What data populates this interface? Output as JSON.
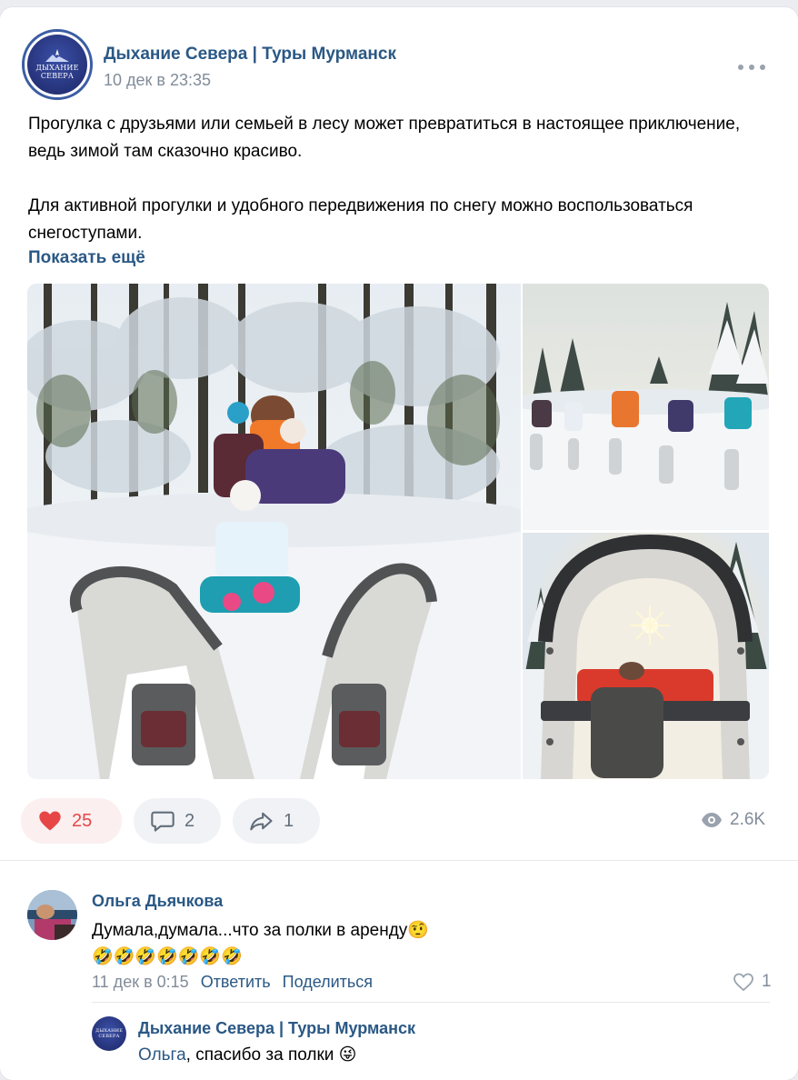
{
  "post": {
    "author": "Дыхание Севера | Туры Мурманск",
    "avatar_text_line1": "ДЫХАНИЕ",
    "avatar_text_line2": "СЕВЕРА",
    "date": "10 дек в 23:35",
    "more_icon": "more-horizontal-icon",
    "paragraph1": "Прогулка с друзьями или семьей в лесу может превратиться в настоящее приключение, ведь зимой там сказочно красиво.",
    "paragraph2": "Для активной прогулки и удобного передвижения по снегу можно воспользоваться снегоступами.",
    "show_more": "Показать ещё",
    "photos": [
      "family-snowshoes-photo",
      "group-hiking-photo",
      "snowshoe-sun-photo"
    ]
  },
  "actions": {
    "likes": "25",
    "comments": "2",
    "shares": "1",
    "views": "2.6K",
    "colors": {
      "like": "#e64646",
      "link": "#2a5885",
      "muted": "#818c99"
    }
  },
  "comment": {
    "author": "Ольга Дьячкова",
    "text": "Думала,думала...что за полки в аренду🤨",
    "emojis": "🤣🤣🤣🤣🤣🤣🤣",
    "date": "11 дек в 0:15",
    "reply_label": "Ответить",
    "share_label": "Поделиться",
    "likes": "1"
  },
  "reply": {
    "author": "Дыхание Севера | Туры Мурманск",
    "mention": "Ольга",
    "text": ", спасибо за полки 😜"
  }
}
